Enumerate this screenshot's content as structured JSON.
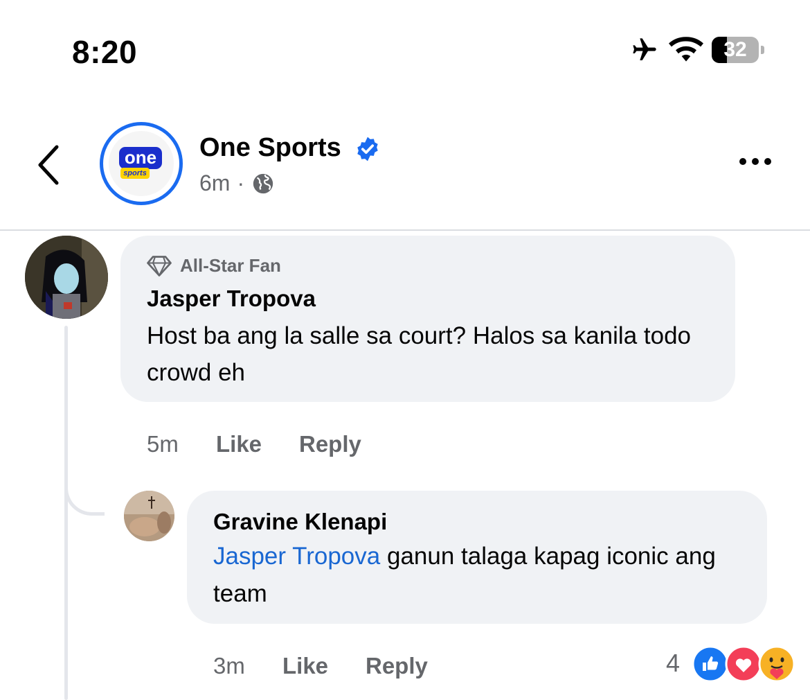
{
  "status_bar": {
    "time": "8:20",
    "battery_level": "32",
    "battery_fraction": 0.32
  },
  "header": {
    "page_name": "One Sports",
    "time_ago": "6m",
    "separator": "·",
    "logo_text": "one",
    "logo_sub": "sports"
  },
  "comments": [
    {
      "badge": "All-Star Fan",
      "author": "Jasper Tropova",
      "text": "Host ba ang la salle sa court? Halos sa kanila todo crowd eh",
      "time_ago": "5m",
      "like_label": "Like",
      "reply_label": "Reply"
    },
    {
      "author": "Gravine Klenapi",
      "mention": "Jasper Tropova",
      "text": " ganun talaga kapag iconic ang team",
      "time_ago": "3m",
      "like_label": "Like",
      "reply_label": "Reply",
      "reaction_count": "4",
      "reactions": [
        "like-icon",
        "love-icon",
        "care-icon"
      ]
    }
  ],
  "colors": {
    "accent": "#1a6bf0",
    "bubble": "#f0f2f5",
    "mention": "#1967d2",
    "secondary_text": "#65676b"
  }
}
